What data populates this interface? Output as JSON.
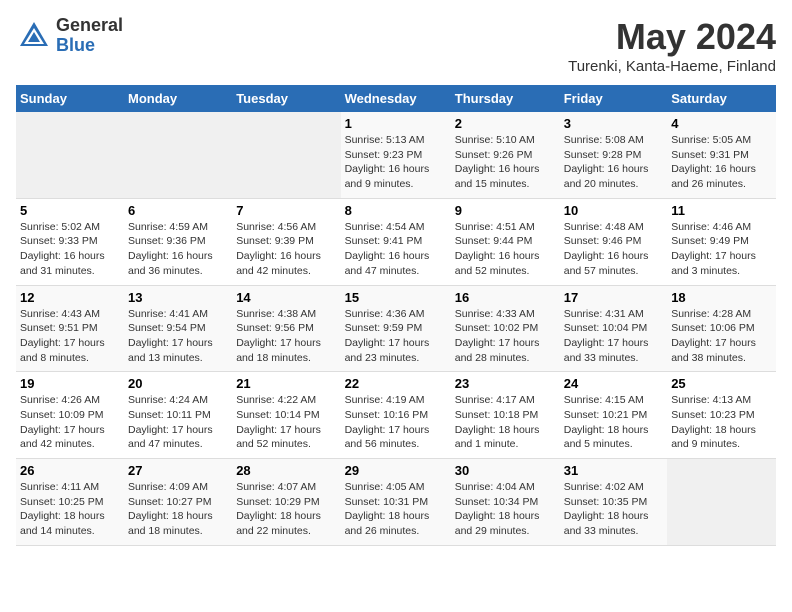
{
  "header": {
    "logo_general": "General",
    "logo_blue": "Blue",
    "month_title": "May 2024",
    "location": "Turenki, Kanta-Haeme, Finland"
  },
  "days_of_week": [
    "Sunday",
    "Monday",
    "Tuesday",
    "Wednesday",
    "Thursday",
    "Friday",
    "Saturday"
  ],
  "weeks": [
    [
      {
        "day": "",
        "info": ""
      },
      {
        "day": "",
        "info": ""
      },
      {
        "day": "",
        "info": ""
      },
      {
        "day": "1",
        "info": "Sunrise: 5:13 AM\nSunset: 9:23 PM\nDaylight: 16 hours and 9 minutes."
      },
      {
        "day": "2",
        "info": "Sunrise: 5:10 AM\nSunset: 9:26 PM\nDaylight: 16 hours and 15 minutes."
      },
      {
        "day": "3",
        "info": "Sunrise: 5:08 AM\nSunset: 9:28 PM\nDaylight: 16 hours and 20 minutes."
      },
      {
        "day": "4",
        "info": "Sunrise: 5:05 AM\nSunset: 9:31 PM\nDaylight: 16 hours and 26 minutes."
      }
    ],
    [
      {
        "day": "5",
        "info": "Sunrise: 5:02 AM\nSunset: 9:33 PM\nDaylight: 16 hours and 31 minutes."
      },
      {
        "day": "6",
        "info": "Sunrise: 4:59 AM\nSunset: 9:36 PM\nDaylight: 16 hours and 36 minutes."
      },
      {
        "day": "7",
        "info": "Sunrise: 4:56 AM\nSunset: 9:39 PM\nDaylight: 16 hours and 42 minutes."
      },
      {
        "day": "8",
        "info": "Sunrise: 4:54 AM\nSunset: 9:41 PM\nDaylight: 16 hours and 47 minutes."
      },
      {
        "day": "9",
        "info": "Sunrise: 4:51 AM\nSunset: 9:44 PM\nDaylight: 16 hours and 52 minutes."
      },
      {
        "day": "10",
        "info": "Sunrise: 4:48 AM\nSunset: 9:46 PM\nDaylight: 16 hours and 57 minutes."
      },
      {
        "day": "11",
        "info": "Sunrise: 4:46 AM\nSunset: 9:49 PM\nDaylight: 17 hours and 3 minutes."
      }
    ],
    [
      {
        "day": "12",
        "info": "Sunrise: 4:43 AM\nSunset: 9:51 PM\nDaylight: 17 hours and 8 minutes."
      },
      {
        "day": "13",
        "info": "Sunrise: 4:41 AM\nSunset: 9:54 PM\nDaylight: 17 hours and 13 minutes."
      },
      {
        "day": "14",
        "info": "Sunrise: 4:38 AM\nSunset: 9:56 PM\nDaylight: 17 hours and 18 minutes."
      },
      {
        "day": "15",
        "info": "Sunrise: 4:36 AM\nSunset: 9:59 PM\nDaylight: 17 hours and 23 minutes."
      },
      {
        "day": "16",
        "info": "Sunrise: 4:33 AM\nSunset: 10:02 PM\nDaylight: 17 hours and 28 minutes."
      },
      {
        "day": "17",
        "info": "Sunrise: 4:31 AM\nSunset: 10:04 PM\nDaylight: 17 hours and 33 minutes."
      },
      {
        "day": "18",
        "info": "Sunrise: 4:28 AM\nSunset: 10:06 PM\nDaylight: 17 hours and 38 minutes."
      }
    ],
    [
      {
        "day": "19",
        "info": "Sunrise: 4:26 AM\nSunset: 10:09 PM\nDaylight: 17 hours and 42 minutes."
      },
      {
        "day": "20",
        "info": "Sunrise: 4:24 AM\nSunset: 10:11 PM\nDaylight: 17 hours and 47 minutes."
      },
      {
        "day": "21",
        "info": "Sunrise: 4:22 AM\nSunset: 10:14 PM\nDaylight: 17 hours and 52 minutes."
      },
      {
        "day": "22",
        "info": "Sunrise: 4:19 AM\nSunset: 10:16 PM\nDaylight: 17 hours and 56 minutes."
      },
      {
        "day": "23",
        "info": "Sunrise: 4:17 AM\nSunset: 10:18 PM\nDaylight: 18 hours and 1 minute."
      },
      {
        "day": "24",
        "info": "Sunrise: 4:15 AM\nSunset: 10:21 PM\nDaylight: 18 hours and 5 minutes."
      },
      {
        "day": "25",
        "info": "Sunrise: 4:13 AM\nSunset: 10:23 PM\nDaylight: 18 hours and 9 minutes."
      }
    ],
    [
      {
        "day": "26",
        "info": "Sunrise: 4:11 AM\nSunset: 10:25 PM\nDaylight: 18 hours and 14 minutes."
      },
      {
        "day": "27",
        "info": "Sunrise: 4:09 AM\nSunset: 10:27 PM\nDaylight: 18 hours and 18 minutes."
      },
      {
        "day": "28",
        "info": "Sunrise: 4:07 AM\nSunset: 10:29 PM\nDaylight: 18 hours and 22 minutes."
      },
      {
        "day": "29",
        "info": "Sunrise: 4:05 AM\nSunset: 10:31 PM\nDaylight: 18 hours and 26 minutes."
      },
      {
        "day": "30",
        "info": "Sunrise: 4:04 AM\nSunset: 10:34 PM\nDaylight: 18 hours and 29 minutes."
      },
      {
        "day": "31",
        "info": "Sunrise: 4:02 AM\nSunset: 10:35 PM\nDaylight: 18 hours and 33 minutes."
      },
      {
        "day": "",
        "info": ""
      }
    ]
  ]
}
